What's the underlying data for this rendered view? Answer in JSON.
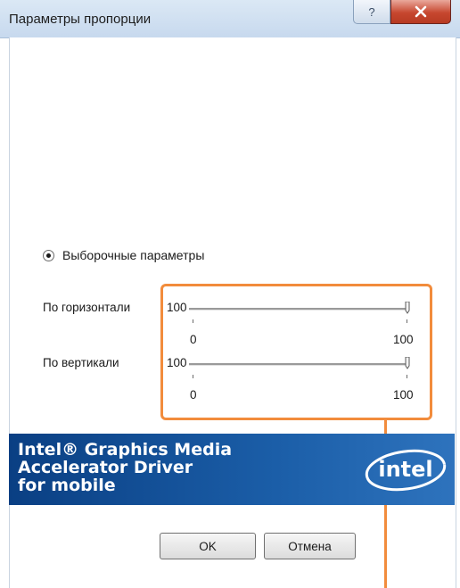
{
  "window": {
    "title": "Параметры пропорции"
  },
  "titlebar": {
    "help_glyph": "?",
    "help_icon": "help-icon",
    "close_icon": "close-icon"
  },
  "options": {
    "radio_label": "Выборочные параметры",
    "selected": true
  },
  "sliders": [
    {
      "label": "По горизонтали",
      "value": "100",
      "min_label": "0",
      "max_label": "100"
    },
    {
      "label": "По вертикали",
      "value": "100",
      "min_label": "0",
      "max_label": "100"
    }
  ],
  "banner": {
    "line1": "Intel® Graphics Media",
    "line2": "Accelerator Driver",
    "line3": "for mobile",
    "logo_text": "intel",
    "color": "#0a3f83"
  },
  "buttons": {
    "ok": "OK",
    "cancel": "Отмена"
  },
  "annotation": {
    "color": "#f28c3c"
  }
}
